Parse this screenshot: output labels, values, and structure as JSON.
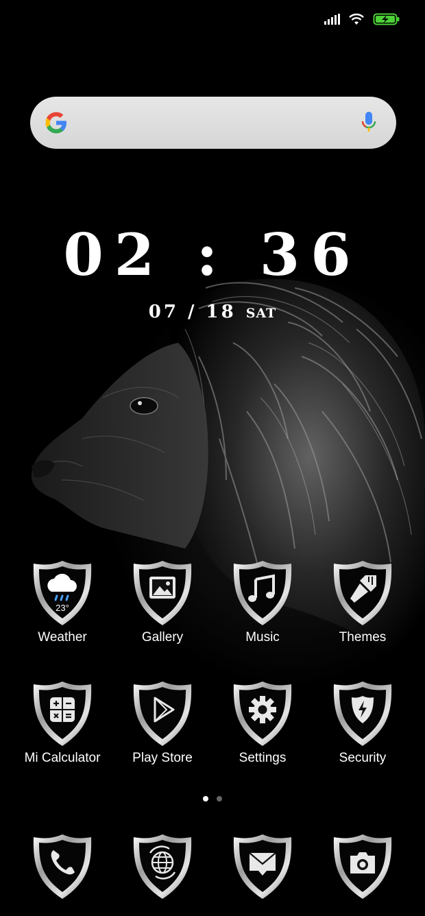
{
  "status_bar": {
    "signal_icon": "cellular-signal-icon",
    "wifi_icon": "wifi-icon",
    "battery_icon": "battery-charging-icon",
    "battery_color": "#4cd137"
  },
  "search": {
    "logo_icon": "google-g-icon",
    "mic_icon": "microphone-icon"
  },
  "clock": {
    "time": "02 : 36",
    "date": "07 / 18",
    "day": "SAT"
  },
  "apps": [
    {
      "label": "Weather",
      "icon": "weather-cloud-rain-icon",
      "temperature": "23°"
    },
    {
      "label": "Gallery",
      "icon": "gallery-image-icon"
    },
    {
      "label": "Music",
      "icon": "music-note-icon"
    },
    {
      "label": "Themes",
      "icon": "paint-brush-icon"
    },
    {
      "label": "Mi Calculator",
      "icon": "calculator-icon"
    },
    {
      "label": "Play Store",
      "icon": "play-store-icon"
    },
    {
      "label": "Settings",
      "icon": "gear-icon"
    },
    {
      "label": "Security",
      "icon": "security-shield-bolt-icon"
    }
  ],
  "page_indicator": {
    "pages": 2,
    "current": 1,
    "active_color": "#ffffff",
    "inactive_color": "#666666"
  },
  "dock": [
    {
      "icon": "phone-icon"
    },
    {
      "icon": "browser-globe-icon"
    },
    {
      "icon": "messaging-envelope-icon"
    },
    {
      "icon": "camera-icon"
    }
  ]
}
